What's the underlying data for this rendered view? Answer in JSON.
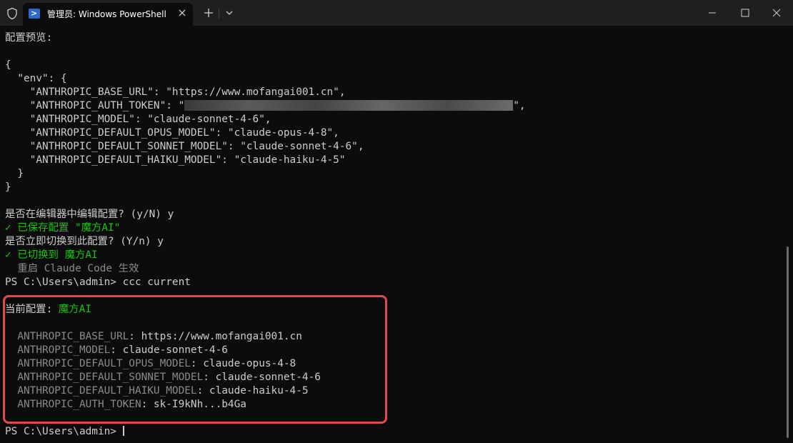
{
  "window": {
    "tab_title": "管理员: Windows PowerShell",
    "tab_icon": "powershell-icon",
    "new_tab_icon": "plus-icon",
    "dropdown_icon": "chevron-down-icon",
    "minimize_icon": "minimize-icon",
    "maximize_icon": "maximize-icon",
    "close_icon": "close-icon"
  },
  "terminal": {
    "lines": [
      "配置预览:",
      "",
      "{",
      "  \"env\": {",
      "    \"ANTHROPIC_BASE_URL\": \"https://www.mofangai001.cn\",",
      "    \"ANTHROPIC_AUTH_TOKEN\": \"",
      "    \"ANTHROPIC_MODEL\": \"claude-sonnet-4-6\",",
      "    \"ANTHROPIC_DEFAULT_OPUS_MODEL\": \"claude-opus-4-8\",",
      "    \"ANTHROPIC_DEFAULT_SONNET_MODEL\": \"claude-sonnet-4-6\",",
      "    \"ANTHROPIC_DEFAULT_HAIKU_MODEL\": \"claude-haiku-4-5\"",
      "  }",
      "}",
      "",
      "是否在编辑器中编辑配置? (y/N) y",
      "✓ 已保存配置 \"魔方AI\"",
      "是否立即切换到此配置? (Y/n) y",
      "✓ 已切换到 ",
      "魔方AI",
      "  重启 Claude Code 生效",
      "PS C:\\Users\\admin> ccc current",
      "",
      "当前配置: ",
      "魔方AI",
      "",
      "  ANTHROPIC_BASE_URL",
      ": https://www.mofangai001.cn",
      "  ANTHROPIC_MODEL",
      ": claude-sonnet-4-6",
      "  ANTHROPIC_DEFAULT_OPUS_MODEL",
      ": claude-opus-4-8",
      "  ANTHROPIC_DEFAULT_SONNET_MODEL",
      ": claude-sonnet-4-6",
      "  ANTHROPIC_DEFAULT_HAIKU_MODEL",
      ": claude-haiku-4-5",
      "  ANTHROPIC_AUTH_TOKEN",
      ": sk-I9kNh...b4Ga",
      "",
      "PS C:\\Users\\admin> ",
      "\","
    ]
  },
  "colors": {
    "background": "#0c0c0c",
    "text": "#cccccc",
    "success": "#16c60c",
    "dim": "#8a8a8a",
    "highlight": "#e24b4b"
  }
}
